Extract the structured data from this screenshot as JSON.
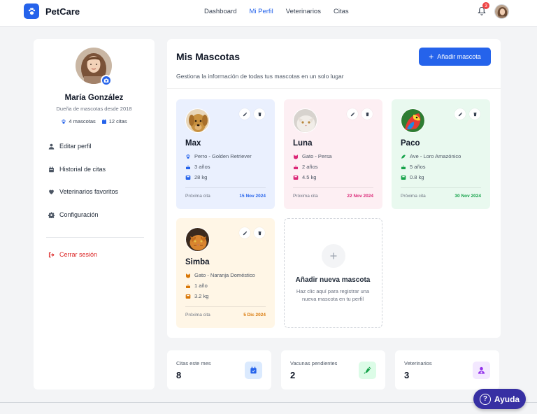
{
  "header": {
    "brand": "PetCare",
    "nav": [
      "Dashboard",
      "Mi Perfil",
      "Veterinarios",
      "Citas"
    ],
    "active_nav": "Mi Perfil",
    "notification_count": "3"
  },
  "profile": {
    "name": "María González",
    "subtitle": "Dueña de mascotas desde 2018",
    "pets_count": "4 mascotas",
    "appointments_count": "12 citas"
  },
  "sidebar": {
    "items": [
      {
        "label": "Editar perfil",
        "icon": "user-icon"
      },
      {
        "label": "Historial de citas",
        "icon": "calendar-icon"
      },
      {
        "label": "Veterinarios favoritos",
        "icon": "heart-icon"
      },
      {
        "label": "Configuración",
        "icon": "gear-icon"
      }
    ],
    "logout": "Cerrar sesión"
  },
  "main": {
    "title": "Mis Mascotas",
    "add_button": "Añadir mascota",
    "subtitle": "Gestiona la información de todas tus mascotas en un solo lugar",
    "next_label": "Próxima cita",
    "pets": [
      {
        "name": "Max",
        "breed": "Perro - Golden Retriever",
        "age": "3 años",
        "weight": "28 kg",
        "next": "15 Nov 2024",
        "bg": "#eaf0fe",
        "accent": "#2563eb"
      },
      {
        "name": "Luna",
        "breed": "Gato - Persa",
        "age": "2 años",
        "weight": "4.5 kg",
        "next": "22 Nov 2024",
        "bg": "#fdeff3",
        "accent": "#db2777"
      },
      {
        "name": "Paco",
        "breed": "Ave - Loro Amazónico",
        "age": "5 años",
        "weight": "0.8 kg",
        "next": "30 Nov 2024",
        "bg": "#e9f9ef",
        "accent": "#16a34a"
      },
      {
        "name": "Simba",
        "breed": "Gato - Naranja Doméstico",
        "age": "1 año",
        "weight": "3.2 kg",
        "next": "5 Dic 2024",
        "bg": "#fff6e6",
        "accent": "#d97706"
      }
    ],
    "add_card": {
      "title": "Añadir nueva mascota",
      "desc": "Haz clic aquí para registrar una nueva mascota en tu perfil"
    }
  },
  "stats": [
    {
      "label": "Citas este mes",
      "value": "8",
      "icon": "calendar-icon",
      "bg": "#dbeafe",
      "fg": "#2563eb"
    },
    {
      "label": "Vacunas pendientes",
      "value": "2",
      "icon": "syringe-icon",
      "bg": "#dcfce7",
      "fg": "#16a34a"
    },
    {
      "label": "Veterinarios",
      "value": "3",
      "icon": "doctor-icon",
      "bg": "#f3e8ff",
      "fg": "#9333ea"
    }
  ],
  "help": {
    "label": "Ayuda"
  }
}
